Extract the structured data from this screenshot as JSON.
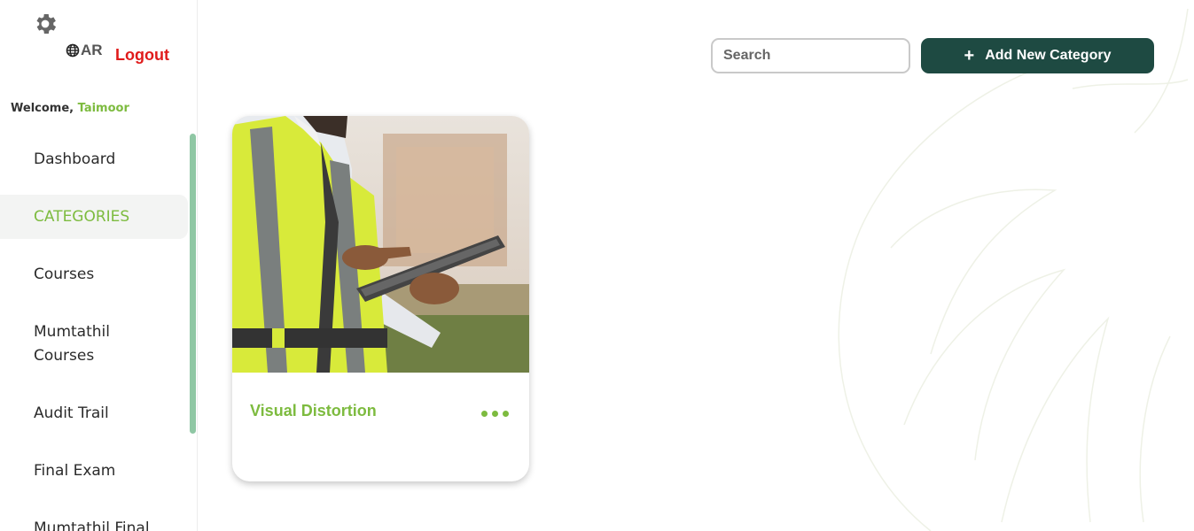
{
  "app": {
    "language_toggle": "AR",
    "logout_label": "Logout",
    "welcome_prefix": "Welcome, ",
    "user_name": "Taimoor"
  },
  "sidebar": {
    "items": [
      {
        "label": "Dashboard",
        "active": false
      },
      {
        "label": "CATEGORIES",
        "active": true
      },
      {
        "label": "Courses",
        "active": false
      },
      {
        "label": "Mumtathil Courses",
        "active": false
      },
      {
        "label": "Audit Trail",
        "active": false
      },
      {
        "label": "Final Exam",
        "active": false
      },
      {
        "label": "Mumtathil Final",
        "active": false
      }
    ]
  },
  "toolbar": {
    "search_placeholder": "Search",
    "add_label": "Add New Category",
    "add_icon": "plus-icon"
  },
  "categories": [
    {
      "title": "Visual Distortion",
      "image": "inspector-with-tablet-photo",
      "menu_icon": "more-dots-icon"
    }
  ],
  "colors": {
    "accent_green": "#7dbb3f",
    "primary_button": "#1e4a42",
    "logout_red": "#e01b1b",
    "scrollbar": "#8fc7a4"
  }
}
